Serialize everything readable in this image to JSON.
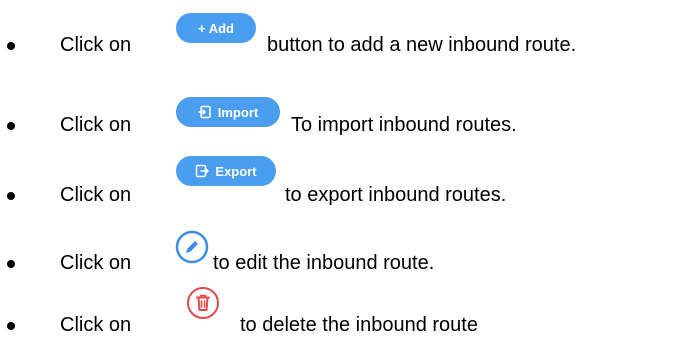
{
  "colors": {
    "button_blue": "#4a9eef",
    "edit_blue": "#3a8ee6",
    "delete_red": "#e04a4a"
  },
  "items": [
    {
      "prefix": "Click on",
      "button_label": "+ Add",
      "suffix": "button to add a new inbound route.",
      "icon": "plus-icon"
    },
    {
      "prefix": "Click on",
      "button_label": "Import",
      "suffix": "To import inbound routes.",
      "icon": "import-icon"
    },
    {
      "prefix": "Click on",
      "button_label": "Export",
      "suffix": "to export inbound routes.",
      "icon": "export-icon"
    },
    {
      "prefix": "Click on",
      "suffix": "to edit the inbound route.",
      "icon": "edit-pencil-icon"
    },
    {
      "prefix": "Click on",
      "suffix": "to delete the inbound route",
      "icon": "delete-trash-icon"
    }
  ]
}
